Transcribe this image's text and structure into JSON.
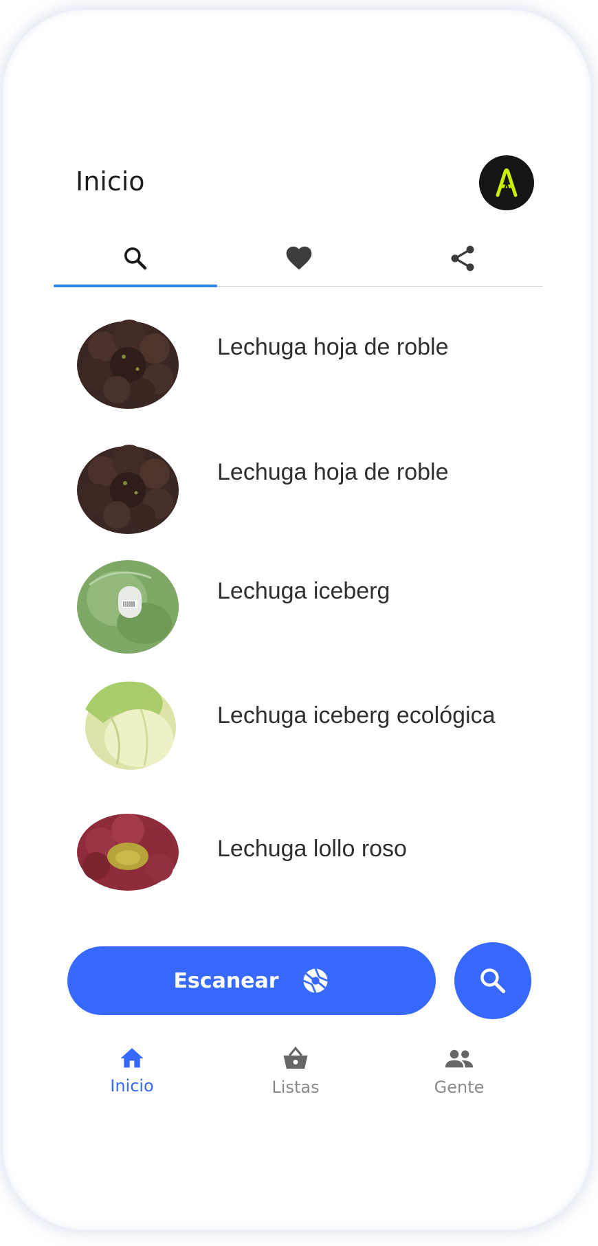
{
  "header": {
    "title": "Inicio"
  },
  "avatar": {
    "letter": "A",
    "bg": "#151515",
    "accent": "#c6f000"
  },
  "tabs": [
    {
      "icon": "search-icon",
      "active": true
    },
    {
      "icon": "heart-icon",
      "active": false
    },
    {
      "icon": "share-icon",
      "active": false
    }
  ],
  "products": [
    {
      "name": "Lechuga hoja de roble",
      "image": "red-oak-leaf-lettuce"
    },
    {
      "name": "Lechuga hoja de roble",
      "image": "red-oak-leaf-lettuce"
    },
    {
      "name": "Lechuga iceberg",
      "image": "wrapped-iceberg-lettuce"
    },
    {
      "name": "Lechuga iceberg ecológica",
      "image": "iceberg-lettuce"
    },
    {
      "name": "Lechuga lollo roso",
      "image": "lollo-rosso-lettuce"
    }
  ],
  "actions": {
    "scan_label": "Escanear",
    "scan_icon": "camera-shutter-icon",
    "search_icon": "search-icon"
  },
  "bottom_nav": [
    {
      "label": "Inicio",
      "icon": "home-icon",
      "active": true
    },
    {
      "label": "Listas",
      "icon": "basket-icon",
      "active": false
    },
    {
      "label": "Gente",
      "icon": "people-icon",
      "active": false
    }
  ],
  "colors": {
    "primary": "#3768ff",
    "tab_indicator": "#2f86e6",
    "inactive": "#8a8a8a"
  }
}
